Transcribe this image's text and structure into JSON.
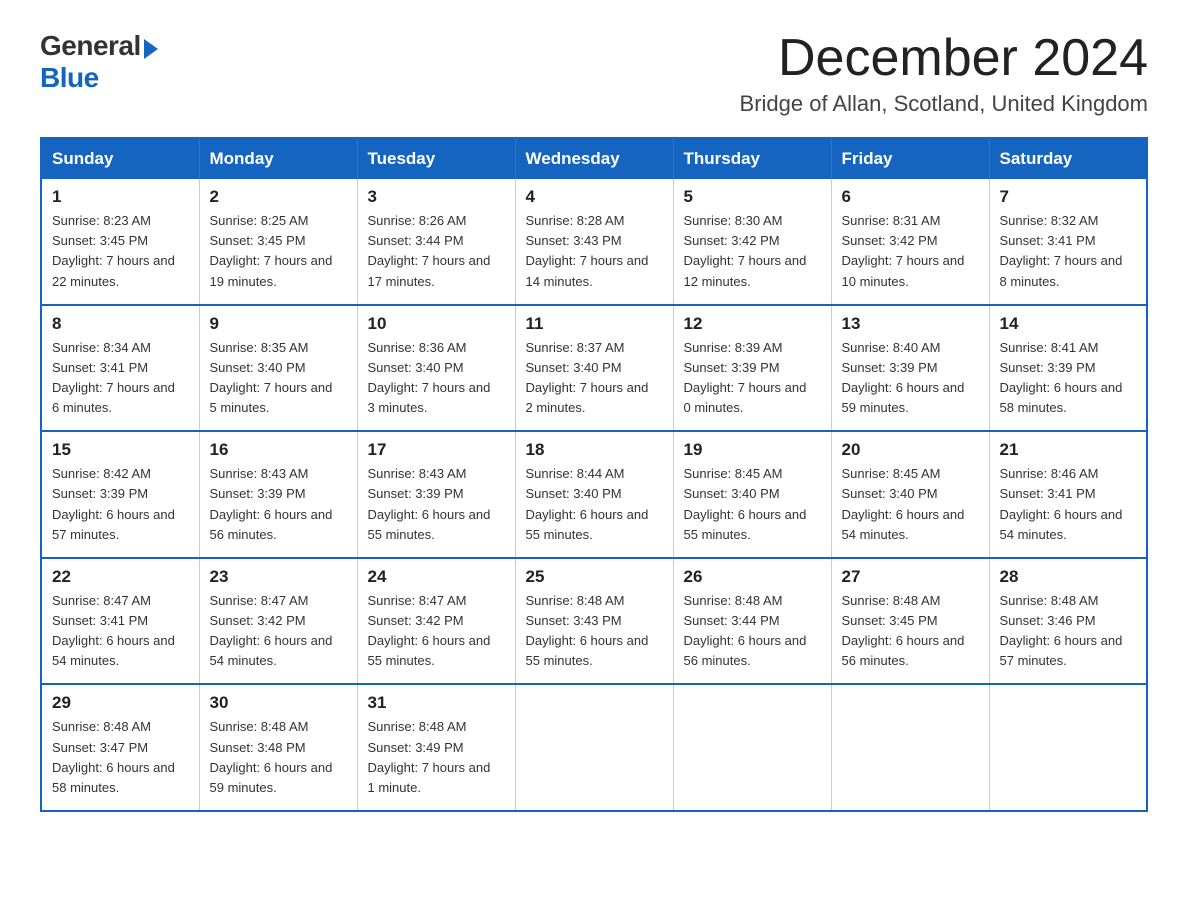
{
  "logo": {
    "general": "General",
    "blue": "Blue"
  },
  "title": "December 2024",
  "subtitle": "Bridge of Allan, Scotland, United Kingdom",
  "days_of_week": [
    "Sunday",
    "Monday",
    "Tuesday",
    "Wednesday",
    "Thursday",
    "Friday",
    "Saturday"
  ],
  "weeks": [
    [
      {
        "day": "1",
        "sunrise": "8:23 AM",
        "sunset": "3:45 PM",
        "daylight": "7 hours and 22 minutes."
      },
      {
        "day": "2",
        "sunrise": "8:25 AM",
        "sunset": "3:45 PM",
        "daylight": "7 hours and 19 minutes."
      },
      {
        "day": "3",
        "sunrise": "8:26 AM",
        "sunset": "3:44 PM",
        "daylight": "7 hours and 17 minutes."
      },
      {
        "day": "4",
        "sunrise": "8:28 AM",
        "sunset": "3:43 PM",
        "daylight": "7 hours and 14 minutes."
      },
      {
        "day": "5",
        "sunrise": "8:30 AM",
        "sunset": "3:42 PM",
        "daylight": "7 hours and 12 minutes."
      },
      {
        "day": "6",
        "sunrise": "8:31 AM",
        "sunset": "3:42 PM",
        "daylight": "7 hours and 10 minutes."
      },
      {
        "day": "7",
        "sunrise": "8:32 AM",
        "sunset": "3:41 PM",
        "daylight": "7 hours and 8 minutes."
      }
    ],
    [
      {
        "day": "8",
        "sunrise": "8:34 AM",
        "sunset": "3:41 PM",
        "daylight": "7 hours and 6 minutes."
      },
      {
        "day": "9",
        "sunrise": "8:35 AM",
        "sunset": "3:40 PM",
        "daylight": "7 hours and 5 minutes."
      },
      {
        "day": "10",
        "sunrise": "8:36 AM",
        "sunset": "3:40 PM",
        "daylight": "7 hours and 3 minutes."
      },
      {
        "day": "11",
        "sunrise": "8:37 AM",
        "sunset": "3:40 PM",
        "daylight": "7 hours and 2 minutes."
      },
      {
        "day": "12",
        "sunrise": "8:39 AM",
        "sunset": "3:39 PM",
        "daylight": "7 hours and 0 minutes."
      },
      {
        "day": "13",
        "sunrise": "8:40 AM",
        "sunset": "3:39 PM",
        "daylight": "6 hours and 59 minutes."
      },
      {
        "day": "14",
        "sunrise": "8:41 AM",
        "sunset": "3:39 PM",
        "daylight": "6 hours and 58 minutes."
      }
    ],
    [
      {
        "day": "15",
        "sunrise": "8:42 AM",
        "sunset": "3:39 PM",
        "daylight": "6 hours and 57 minutes."
      },
      {
        "day": "16",
        "sunrise": "8:43 AM",
        "sunset": "3:39 PM",
        "daylight": "6 hours and 56 minutes."
      },
      {
        "day": "17",
        "sunrise": "8:43 AM",
        "sunset": "3:39 PM",
        "daylight": "6 hours and 55 minutes."
      },
      {
        "day": "18",
        "sunrise": "8:44 AM",
        "sunset": "3:40 PM",
        "daylight": "6 hours and 55 minutes."
      },
      {
        "day": "19",
        "sunrise": "8:45 AM",
        "sunset": "3:40 PM",
        "daylight": "6 hours and 55 minutes."
      },
      {
        "day": "20",
        "sunrise": "8:45 AM",
        "sunset": "3:40 PM",
        "daylight": "6 hours and 54 minutes."
      },
      {
        "day": "21",
        "sunrise": "8:46 AM",
        "sunset": "3:41 PM",
        "daylight": "6 hours and 54 minutes."
      }
    ],
    [
      {
        "day": "22",
        "sunrise": "8:47 AM",
        "sunset": "3:41 PM",
        "daylight": "6 hours and 54 minutes."
      },
      {
        "day": "23",
        "sunrise": "8:47 AM",
        "sunset": "3:42 PM",
        "daylight": "6 hours and 54 minutes."
      },
      {
        "day": "24",
        "sunrise": "8:47 AM",
        "sunset": "3:42 PM",
        "daylight": "6 hours and 55 minutes."
      },
      {
        "day": "25",
        "sunrise": "8:48 AM",
        "sunset": "3:43 PM",
        "daylight": "6 hours and 55 minutes."
      },
      {
        "day": "26",
        "sunrise": "8:48 AM",
        "sunset": "3:44 PM",
        "daylight": "6 hours and 56 minutes."
      },
      {
        "day": "27",
        "sunrise": "8:48 AM",
        "sunset": "3:45 PM",
        "daylight": "6 hours and 56 minutes."
      },
      {
        "day": "28",
        "sunrise": "8:48 AM",
        "sunset": "3:46 PM",
        "daylight": "6 hours and 57 minutes."
      }
    ],
    [
      {
        "day": "29",
        "sunrise": "8:48 AM",
        "sunset": "3:47 PM",
        "daylight": "6 hours and 58 minutes."
      },
      {
        "day": "30",
        "sunrise": "8:48 AM",
        "sunset": "3:48 PM",
        "daylight": "6 hours and 59 minutes."
      },
      {
        "day": "31",
        "sunrise": "8:48 AM",
        "sunset": "3:49 PM",
        "daylight": "7 hours and 1 minute."
      },
      null,
      null,
      null,
      null
    ]
  ],
  "labels": {
    "sunrise": "Sunrise:",
    "sunset": "Sunset:",
    "daylight": "Daylight:"
  }
}
